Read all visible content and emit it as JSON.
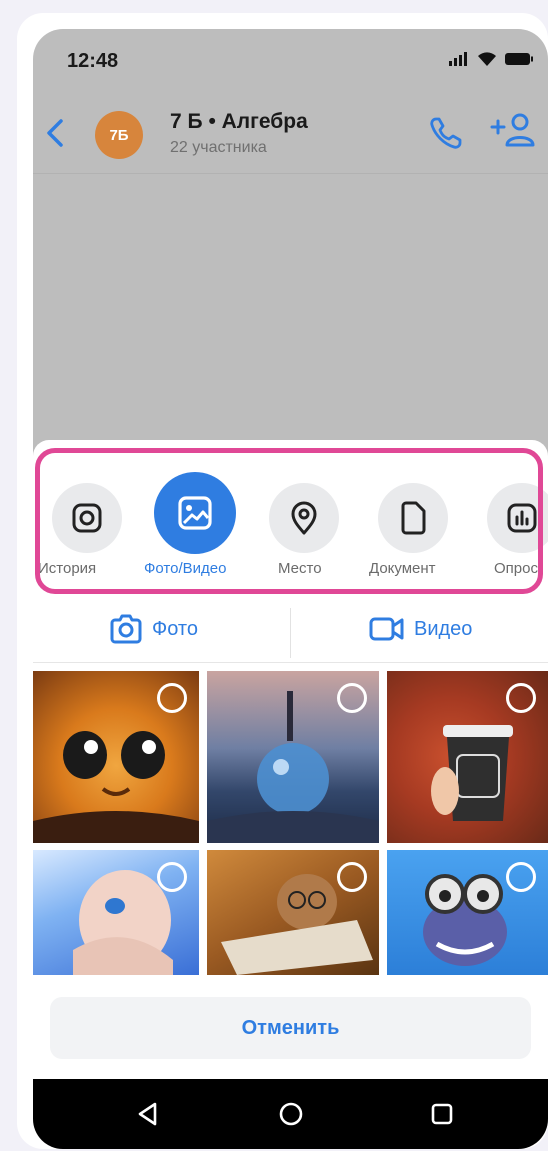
{
  "status": {
    "time": "12:48"
  },
  "header": {
    "avatar_initials": "7Б",
    "title": "7 Б • Алгебра",
    "subtitle": "22 участника"
  },
  "attachments": {
    "items": [
      {
        "label": "История",
        "icon": "instagram-icon",
        "active": false
      },
      {
        "label": "Фото/Видео",
        "icon": "image-icon",
        "active": true
      },
      {
        "label": "Место",
        "icon": "location-pin-icon",
        "active": false
      },
      {
        "label": "Документ",
        "icon": "document-icon",
        "active": false
      },
      {
        "label": "Опрос",
        "icon": "poll-icon",
        "active": false
      }
    ]
  },
  "tabs": {
    "photo_label": "Фото",
    "video_label": "Видео"
  },
  "gallery": [
    {
      "subject": "orange cat with big eyes"
    },
    {
      "subject": "glass ball on pebbles"
    },
    {
      "subject": "coffee cup autumn leaf"
    },
    {
      "subject": "animated girl blue hair"
    },
    {
      "subject": "cat with glasses and newspaper"
    },
    {
      "subject": "crazy frog with goggles"
    }
  ],
  "cancel_label": "Отменить",
  "colors": {
    "accent": "#2f7de1",
    "highlight": "#e04896",
    "avatar": "#d7853c",
    "overlay": "#bdbdbd"
  }
}
